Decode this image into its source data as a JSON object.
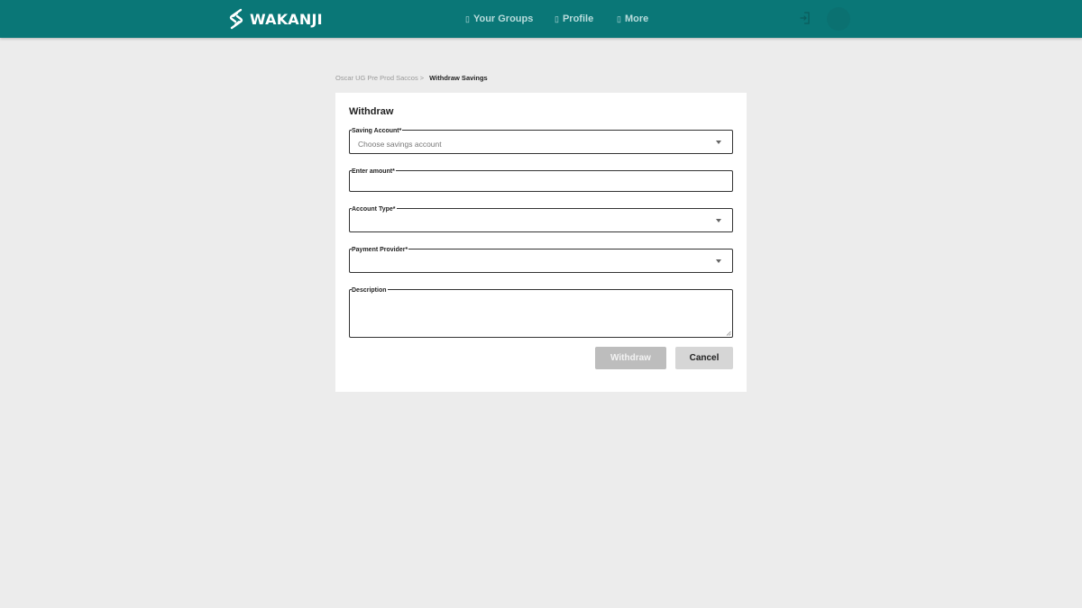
{
  "brand": {
    "name": "WAKANJI",
    "icon": "wakanji-logo-icon"
  },
  "nav": {
    "items": [
      {
        "label": "Your Groups",
        "icon": "missing-glyph-icon",
        "glyph": "▯"
      },
      {
        "label": "Profile",
        "icon": "missing-glyph-icon",
        "glyph": "▯"
      },
      {
        "label": "More",
        "icon": "missing-glyph-icon",
        "glyph": "▯"
      }
    ],
    "logout_icon": "logout-icon",
    "avatar_icon": "avatar-icon"
  },
  "breadcrumb": {
    "parent": "Oscar UG Pre Prod Saccos >",
    "current": "Withdraw Savings"
  },
  "form": {
    "title": "Withdraw",
    "saving_account": {
      "label": "Saving Account*",
      "placeholder": "Choose savings account",
      "value": ""
    },
    "amount": {
      "label": "Enter amount*",
      "value": ""
    },
    "account_type": {
      "label": "Account Type*",
      "value": ""
    },
    "payment_provider": {
      "label": "Payment Provider*",
      "value": ""
    },
    "description": {
      "label": "Description",
      "value": ""
    },
    "withdraw_label": "Withdraw",
    "cancel_label": "Cancel"
  },
  "colors": {
    "header": "#0a7777",
    "page_background": "#ececec",
    "withdraw_button_disabled": "#bdbdbd",
    "cancel_button": "#d6d6d6"
  }
}
